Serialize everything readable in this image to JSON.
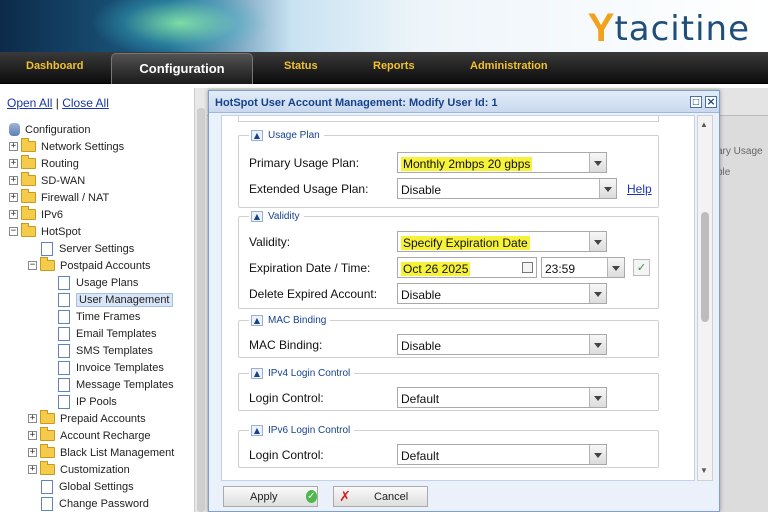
{
  "brand": {
    "logo_text": "tacitine"
  },
  "nav": {
    "dashboard": "Dashboard",
    "configuration": "Configuration",
    "status": "Status",
    "reports": "Reports",
    "administration": "Administration"
  },
  "sidebar": {
    "open_all": "Open All",
    "separator": "|",
    "close_all": "Close All",
    "root": "Configuration",
    "items": {
      "network_settings": "Network Settings",
      "routing": "Routing",
      "sdwan": "SD-WAN",
      "firewall": "Firewall / NAT",
      "ipv6": "IPv6",
      "hotspot": "HotSpot",
      "server_settings": "Server Settings",
      "postpaid_accounts": "Postpaid Accounts",
      "usage_plans": "Usage Plans",
      "user_management": "User Management",
      "time_frames": "Time Frames",
      "email_templates": "Email Templates",
      "sms_templates": "SMS Templates",
      "invoice_templates": "Invoice Templates",
      "message_templates": "Message Templates",
      "ip_pools": "IP Pools",
      "prepaid_accounts": "Prepaid Accounts",
      "account_recharge": "Account Recharge",
      "black_list": "Black List Management",
      "customization": "Customization",
      "global_settings": "Global Settings",
      "change_password": "Change Password"
    }
  },
  "background": {
    "col_fragment": "ary Usage",
    "row_fragment": "ple"
  },
  "dialog": {
    "title": "HotSpot User Account Management: Modify User Id: 1",
    "usage_plan": {
      "legend": "Usage Plan",
      "primary_label": "Primary Usage Plan:",
      "primary_value": "Monthly 2mbps 20 gbps",
      "extended_label": "Extended Usage Plan:",
      "extended_value": "Disable",
      "help": "Help"
    },
    "validity": {
      "legend": "Validity",
      "validity_label": "Validity:",
      "validity_value": "Specify Expiration Date",
      "expiration_label": "Expiration Date / Time:",
      "date_value": "Oct 26 2025",
      "time_value": "23:59",
      "delete_label": "Delete Expired Account:",
      "delete_value": "Disable"
    },
    "mac": {
      "legend": "MAC Binding",
      "label": "MAC Binding:",
      "value": "Disable"
    },
    "ipv4": {
      "legend": "IPv4 Login Control",
      "label": "Login Control:",
      "value": "Default"
    },
    "ipv6": {
      "legend": "IPv6 Login Control",
      "label": "Login Control:",
      "value": "Default"
    },
    "apply": "Apply",
    "cancel": "Cancel"
  }
}
